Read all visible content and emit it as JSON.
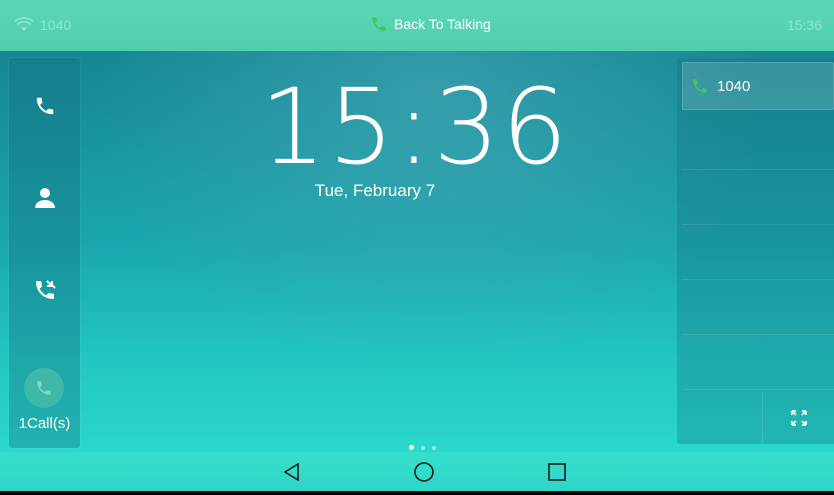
{
  "status_bar": {
    "account": "1040",
    "back_to_talking": "Back To Talking",
    "time": "15:36"
  },
  "dock": {
    "items": [
      {
        "icon": "phone-icon"
      },
      {
        "icon": "contacts-icon"
      },
      {
        "icon": "call-history-icon"
      }
    ],
    "calls_label": "1Call(s)"
  },
  "clock": {
    "time": "15:36",
    "date": "Tue, February 7"
  },
  "lines": {
    "active_line": "1040"
  },
  "pager": {
    "pages": 3,
    "current": 1
  },
  "colors": {
    "accent_green": "#3ec85a",
    "status_bar": "#55d3b2"
  }
}
